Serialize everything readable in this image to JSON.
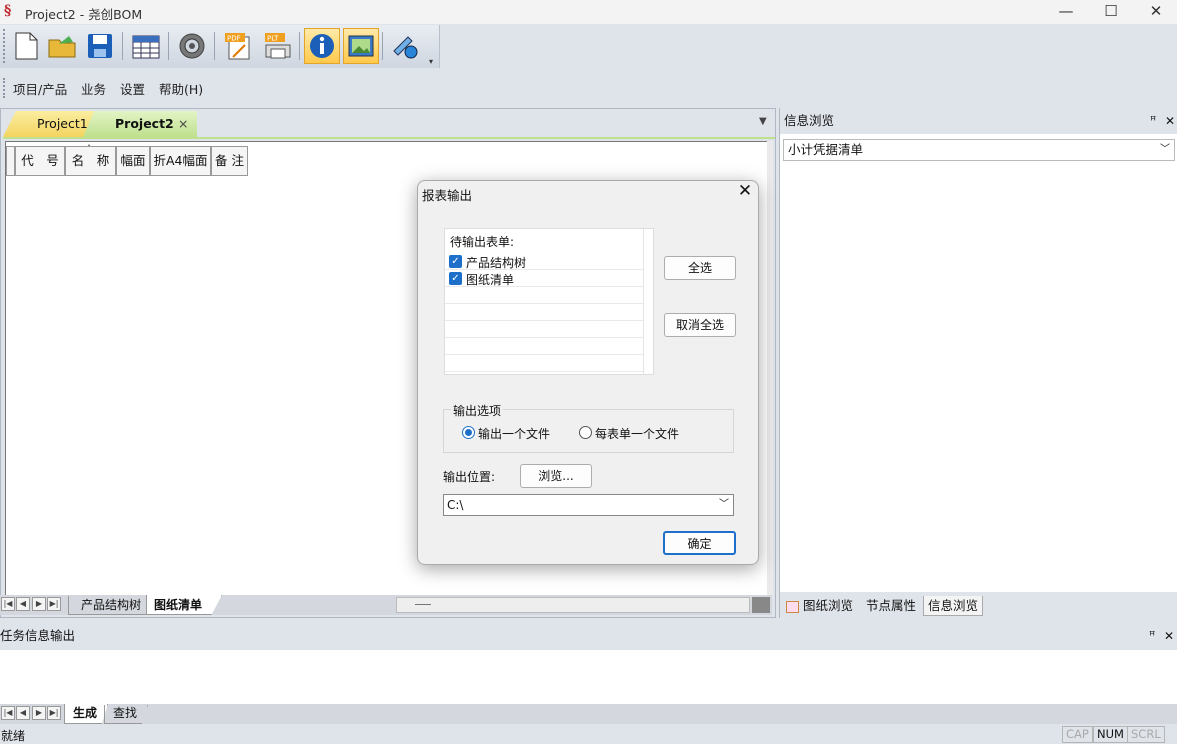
{
  "window": {
    "title": "Project2 - 尧创BOM",
    "app_icon": "尧创",
    "min_label": "—",
    "max_label": "☐",
    "close_label": "✕"
  },
  "menu": [
    "项目/产品",
    "业务",
    "设置",
    "帮助(H)"
  ],
  "doc_tabs": {
    "tab1": "Project1",
    "tab2": "Project2",
    "close": "×"
  },
  "grid": {
    "headers": [
      "代　号",
      "名　称",
      "幅面",
      "折A4幅面",
      "备 注"
    ]
  },
  "sheet_tabs": [
    "产品结构树",
    "图纸清单"
  ],
  "right_panel": {
    "title": "信息浏览",
    "select_value": "小计凭据清单",
    "tabs": [
      "图纸浏览",
      "节点属性",
      "信息浏览"
    ]
  },
  "task_panel": {
    "title": "任务信息输出",
    "tabs": [
      "生成",
      "查找"
    ]
  },
  "status": {
    "text": "就绪",
    "cap": "CAP",
    "num": "NUM",
    "scrl": "SCRL"
  },
  "dialog": {
    "title": "报表输出",
    "list_header": "待输出表单:",
    "items": [
      {
        "label": "产品结构树",
        "checked": true
      },
      {
        "label": "图纸清单",
        "checked": true
      }
    ],
    "select_all": "全选",
    "deselect_all": "取消全选",
    "options_group": "输出选项",
    "option_one": "输出一个文件",
    "option_each": "每表单一个文件",
    "location_label": "输出位置:",
    "browse": "浏览...",
    "path": "C:\\",
    "ok": "确定"
  },
  "colors": {
    "accent": "#1d6fc9",
    "tab_active": "#c9e79a",
    "tab_yellow": "#f7df7a"
  }
}
